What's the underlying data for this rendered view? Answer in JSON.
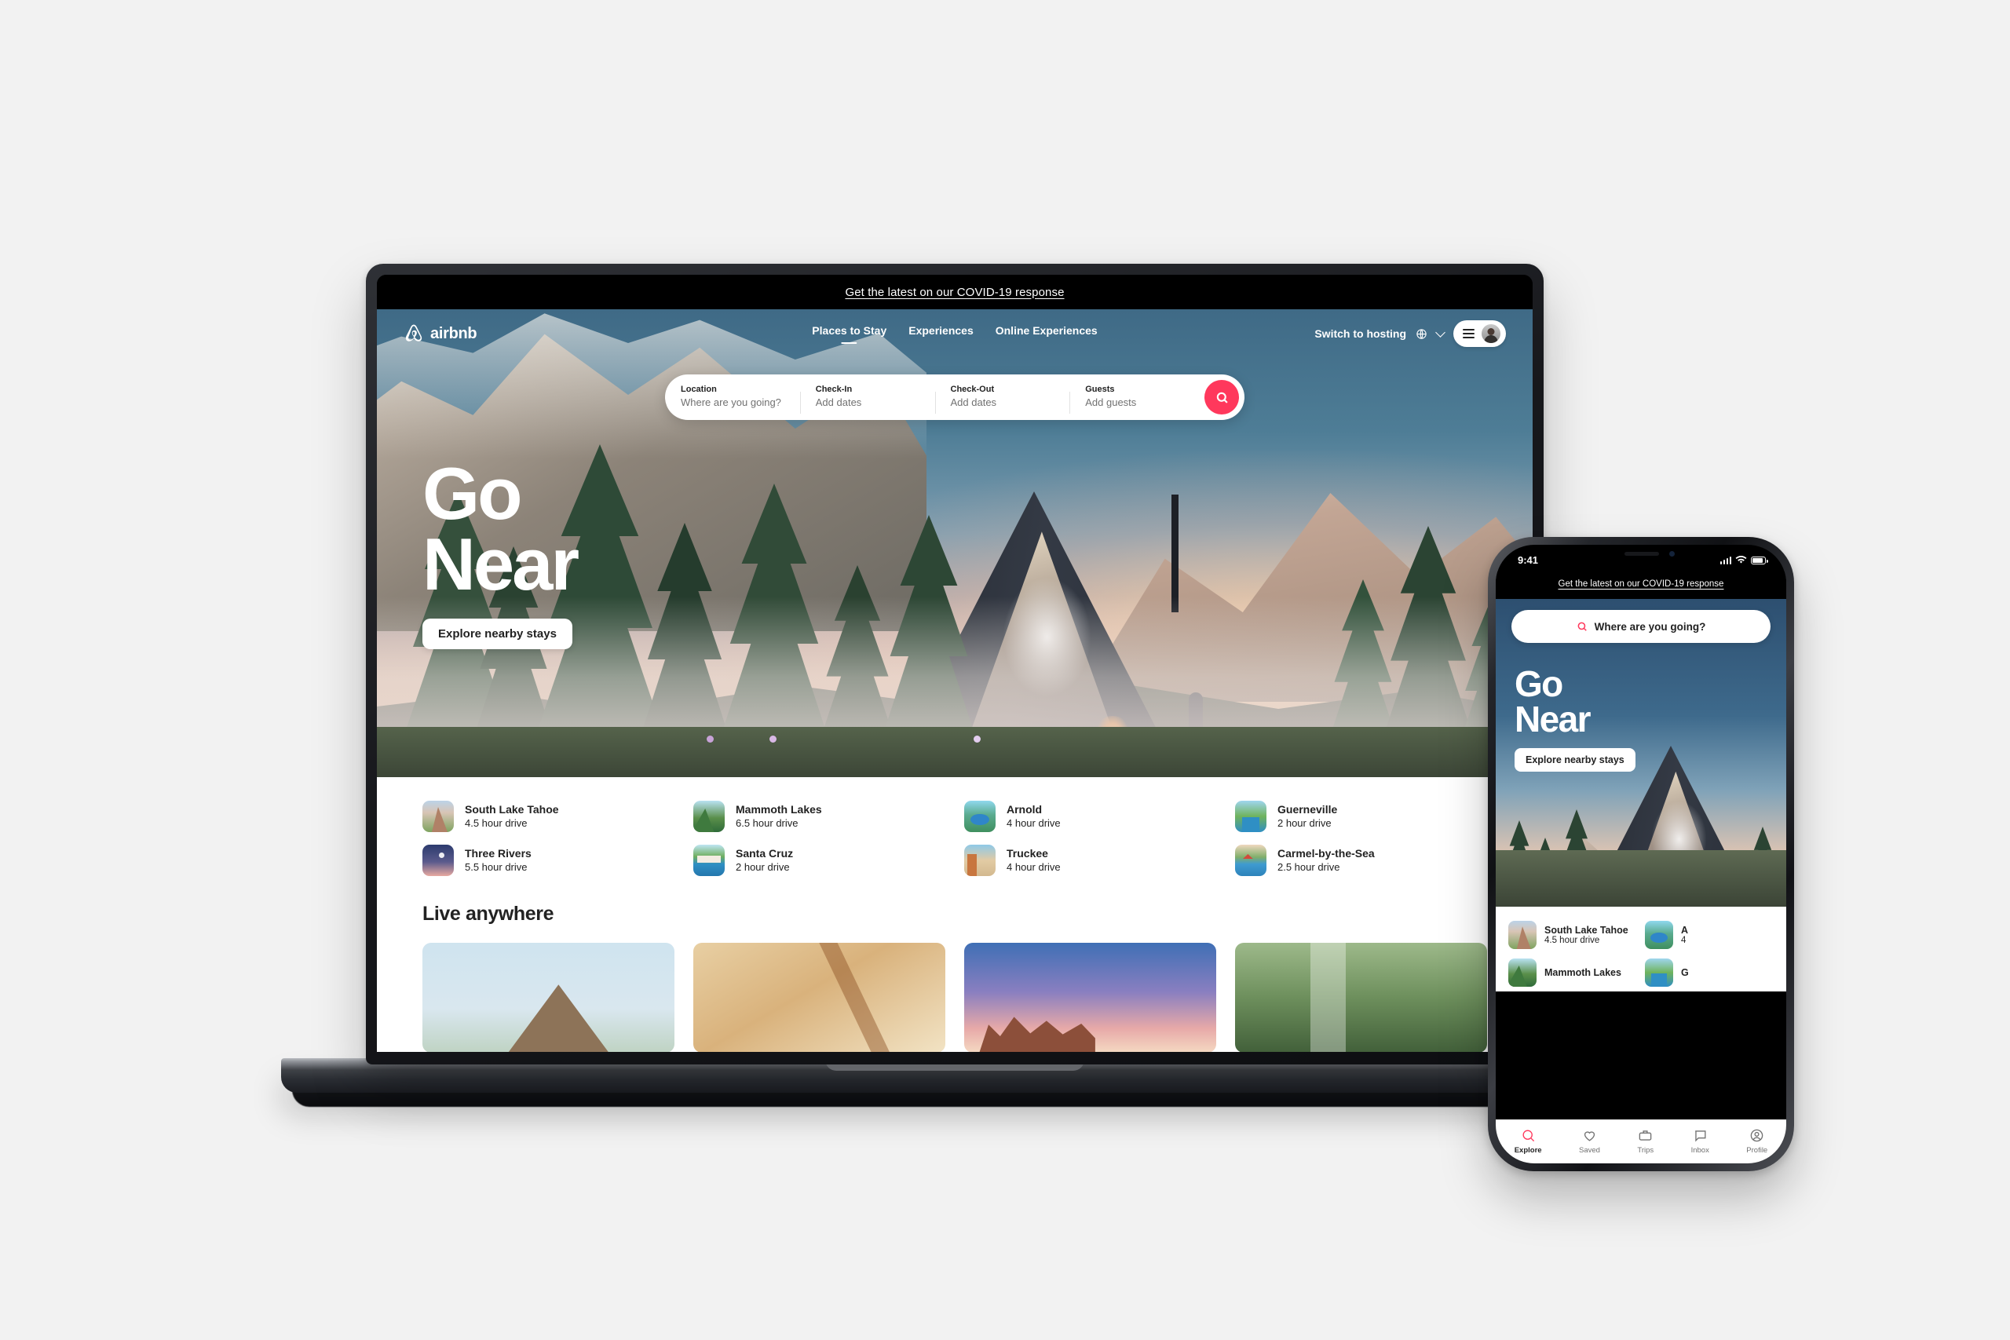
{
  "background_color": "#f2f2f2",
  "brand": {
    "name": "airbnb",
    "accent_color": "#ff385c",
    "logo_icon": "airbnb-belo-icon"
  },
  "desktop": {
    "covid_banner": {
      "text": "Get the latest on our COVID-19 response"
    },
    "nav": {
      "tabs": [
        {
          "label": "Places to Stay",
          "active": true
        },
        {
          "label": "Experiences",
          "active": false
        },
        {
          "label": "Online Experiences",
          "active": false
        }
      ],
      "host_link": "Switch to hosting",
      "globe_icon": "globe-icon",
      "chevron_icon": "chevron-down-icon",
      "menu_icon": "hamburger-menu-icon",
      "avatar_icon": "user-avatar-icon"
    },
    "search": {
      "fields": [
        {
          "label": "Location",
          "value": "Where are you going?"
        },
        {
          "label": "Check-In",
          "value": "Add dates"
        },
        {
          "label": "Check-Out",
          "value": "Add dates"
        },
        {
          "label": "Guests",
          "value": "Add guests"
        }
      ],
      "search_icon": "search-icon"
    },
    "hero": {
      "line1": "Go",
      "line2": "Near",
      "cta": "Explore nearby stays"
    },
    "destinations": [
      {
        "name": "South Lake Tahoe",
        "drive": "4.5 hour drive",
        "thumb": "th-tahoe"
      },
      {
        "name": "Mammoth Lakes",
        "drive": "6.5 hour drive",
        "thumb": "th-mammoth"
      },
      {
        "name": "Arnold",
        "drive": "4 hour drive",
        "thumb": "th-arnold"
      },
      {
        "name": "Guerneville",
        "drive": "2 hour drive",
        "thumb": "th-guerne"
      },
      {
        "name": "Three Rivers",
        "drive": "5.5 hour drive",
        "thumb": "th-rivers"
      },
      {
        "name": "Santa Cruz",
        "drive": "2 hour drive",
        "thumb": "th-santacruz"
      },
      {
        "name": "Truckee",
        "drive": "4 hour drive",
        "thumb": "th-truckee"
      },
      {
        "name": "Carmel-by-the-Sea",
        "drive": "2.5 hour drive",
        "thumb": "th-carmel"
      }
    ],
    "live_anywhere": {
      "title": "Live anywhere",
      "cards": [
        "a-frame-cabin-exterior",
        "a-frame-interior-wood",
        "desert-sunset-rocks",
        "forest-cabin-window"
      ]
    }
  },
  "mobile": {
    "status": {
      "time": "9:41",
      "signal_icon": "cellular-bars-icon",
      "wifi_icon": "wifi-icon",
      "battery_icon": "battery-icon"
    },
    "covid_banner": {
      "text": "Get the latest on our COVID-19 response"
    },
    "search": {
      "placeholder": "Where are you going?",
      "search_icon": "search-icon"
    },
    "hero": {
      "line1": "Go",
      "line2": "Near",
      "cta": "Explore nearby stays"
    },
    "destinations": [
      {
        "name": "South Lake Tahoe",
        "drive": "4.5 hour drive",
        "thumb": "th-tahoe"
      },
      {
        "name": "A",
        "drive": "4",
        "thumb": "th-arnold"
      },
      {
        "name": "Mammoth Lakes",
        "drive": "",
        "thumb": "th-mammoth"
      },
      {
        "name": "G",
        "drive": "",
        "thumb": "th-guerne"
      }
    ],
    "tabbar": [
      {
        "label": "Explore",
        "icon": "search-icon",
        "active": true
      },
      {
        "label": "Saved",
        "icon": "heart-icon",
        "active": false
      },
      {
        "label": "Trips",
        "icon": "suitcase-icon",
        "active": false
      },
      {
        "label": "Inbox",
        "icon": "chat-bubble-icon",
        "active": false
      },
      {
        "label": "Profile",
        "icon": "user-circle-icon",
        "active": false
      }
    ]
  }
}
